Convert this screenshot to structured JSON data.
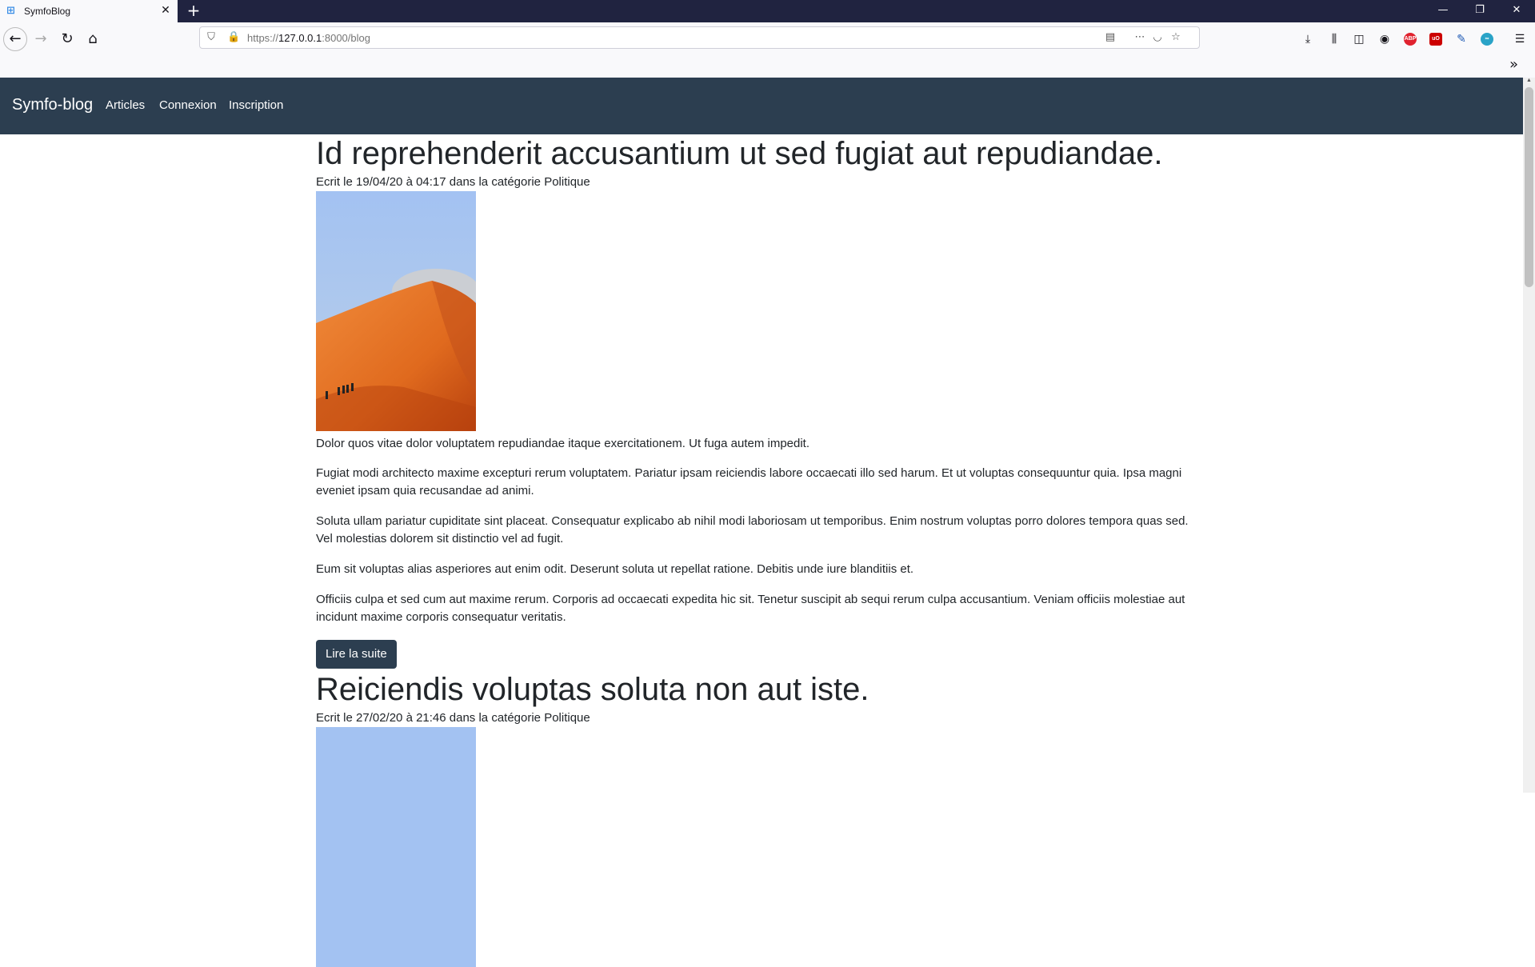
{
  "browser": {
    "tab_title": "SymfoBlog",
    "tab_close": "✕",
    "new_tab": "+",
    "url_prefix": "https://",
    "url_host": "127.0.0.1",
    "url_rest": ":8000/blog",
    "window_controls": [
      "—",
      "❐",
      "✕"
    ]
  },
  "site": {
    "brand": "Symfo-blog",
    "nav": [
      "Articles",
      "Connexion",
      "Inscription"
    ]
  },
  "articles": [
    {
      "title": "Id reprehenderit accusantium ut sed fugiat aut repudiandae.",
      "meta": "Ecrit le 19/04/20 à 04:17 dans la catégorie Politique",
      "paragraphs": [
        "Dolor quos vitae dolor voluptatem repudiandae itaque exercitationem. Ut fuga autem impedit.",
        "Fugiat modi architecto maxime excepturi rerum voluptatem. Pariatur ipsam reiciendis labore occaecati illo sed harum. Et ut voluptas consequuntur quia. Ipsa magni eveniet ipsam quia recusandae ad animi.",
        "Soluta ullam pariatur cupiditate sint placeat. Consequatur explicabo ab nihil modi laboriosam ut temporibus. Enim nostrum voluptas porro dolores tempora quas sed. Vel molestias dolorem sit distinctio vel ad fugit.",
        "Eum sit voluptas alias asperiores aut enim odit. Deserunt soluta ut repellat ratione. Debitis unde iure blanditiis et.",
        "Officiis culpa et sed cum aut maxime rerum. Corporis ad occaecati expedita hic sit. Tenetur suscipit ab sequi rerum culpa accusantium. Veniam officiis molestiae aut incidunt maxime corporis consequatur veritatis."
      ],
      "button": "Lire la suite"
    },
    {
      "title": "Reiciendis voluptas soluta non aut iste.",
      "meta": "Ecrit le 27/02/20 à 21:46 dans la catégorie Politique"
    }
  ],
  "colors": {
    "navbar": "#2c3e50",
    "tabbar": "#202340",
    "text": "#212529"
  }
}
